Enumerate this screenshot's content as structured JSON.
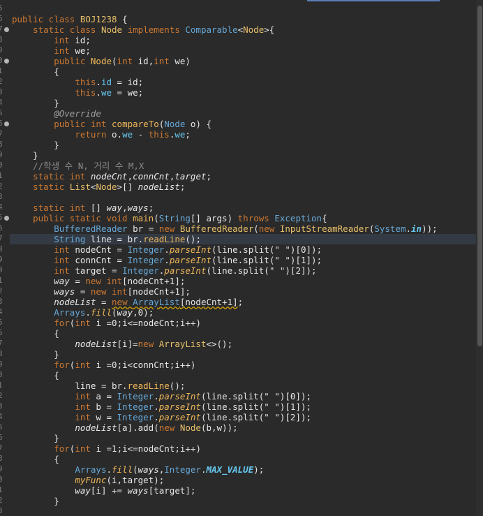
{
  "colors": {
    "background": "#2a2a2a",
    "keyword": "#cc7832",
    "type": "#66a8d8",
    "class": "#e8c06a",
    "field": "#66c8f0",
    "comment": "#8a8a8a"
  },
  "gutter": {
    "line_numbers": [
      "5",
      "6",
      "7",
      "8",
      "9",
      "0",
      "1",
      "2",
      "3",
      "4",
      "5",
      "6",
      "7",
      "8",
      "9",
      "0",
      "1",
      "2",
      "3",
      "4",
      "5",
      "6",
      "7",
      "8",
      "9",
      "0",
      "1",
      "2",
      "3",
      "4",
      "5",
      "6",
      "7",
      "8",
      "9",
      "0",
      "1",
      "2",
      "3",
      "4",
      "5",
      "6",
      "7",
      "8",
      "9",
      "0",
      "1",
      "2",
      "3"
    ]
  },
  "lines": [
    [
      [
        "kw",
        "public class "
      ],
      [
        "cls",
        "BOJ1238"
      ],
      [
        "plain",
        " {"
      ]
    ],
    [
      [
        "plain",
        "    "
      ],
      [
        "kw",
        "static class "
      ],
      [
        "cls",
        "Node"
      ],
      [
        "kw",
        " implements "
      ],
      [
        "type",
        "Comparable"
      ],
      [
        "plain",
        "<"
      ],
      [
        "cls",
        "Node"
      ],
      [
        "plain",
        ">{"
      ]
    ],
    [
      [
        "plain",
        "        "
      ],
      [
        "kw",
        "int "
      ],
      [
        "var",
        "id"
      ],
      [
        "plain",
        ";"
      ]
    ],
    [
      [
        "plain",
        "        "
      ],
      [
        "kw",
        "int "
      ],
      [
        "var",
        "we"
      ],
      [
        "plain",
        ";"
      ]
    ],
    [
      [
        "plain",
        "        "
      ],
      [
        "kw",
        "public "
      ],
      [
        "fn",
        "Node"
      ],
      [
        "plain",
        "("
      ],
      [
        "kw",
        "int "
      ],
      [
        "var",
        "id"
      ],
      [
        "plain",
        ","
      ],
      [
        "kw",
        "int "
      ],
      [
        "var",
        "we"
      ],
      [
        "plain",
        ")"
      ]
    ],
    [
      [
        "plain",
        "        {"
      ]
    ],
    [
      [
        "plain",
        "            "
      ],
      [
        "kw",
        "this"
      ],
      [
        "plain",
        "."
      ],
      [
        "fld",
        "id"
      ],
      [
        "plain",
        " = "
      ],
      [
        "var",
        "id"
      ],
      [
        "plain",
        ";"
      ]
    ],
    [
      [
        "plain",
        "            "
      ],
      [
        "kw",
        "this"
      ],
      [
        "plain",
        "."
      ],
      [
        "fld",
        "we"
      ],
      [
        "plain",
        " = "
      ],
      [
        "var",
        "we"
      ],
      [
        "plain",
        ";"
      ]
    ],
    [
      [
        "plain",
        "        }"
      ]
    ],
    [
      [
        "plain",
        "        "
      ],
      [
        "ann",
        "@Override"
      ]
    ],
    [
      [
        "plain",
        "        "
      ],
      [
        "kw",
        "public int "
      ],
      [
        "fn",
        "compareTo"
      ],
      [
        "plain",
        "("
      ],
      [
        "type",
        "Node "
      ],
      [
        "var",
        "o"
      ],
      [
        "plain",
        ") {"
      ]
    ],
    [
      [
        "plain",
        "            "
      ],
      [
        "kw",
        "return "
      ],
      [
        "var",
        "o"
      ],
      [
        "plain",
        "."
      ],
      [
        "fld",
        "we"
      ],
      [
        "plain",
        " - "
      ],
      [
        "kw",
        "this"
      ],
      [
        "plain",
        "."
      ],
      [
        "fld",
        "we"
      ],
      [
        "plain",
        ";"
      ]
    ],
    [
      [
        "plain",
        "        }"
      ]
    ],
    [
      [
        "plain",
        "    }"
      ]
    ],
    [
      [
        "plain",
        "    "
      ],
      [
        "cmt",
        "//학생 수 N, 거리 수 M,X"
      ]
    ],
    [
      [
        "plain",
        "    "
      ],
      [
        "kw",
        "static int "
      ],
      [
        "var it",
        "nodeCnt"
      ],
      [
        "plain",
        ","
      ],
      [
        "var it",
        "connCnt"
      ],
      [
        "plain",
        ","
      ],
      [
        "var it",
        "target"
      ],
      [
        "plain",
        ";"
      ]
    ],
    [
      [
        "plain",
        "    "
      ],
      [
        "kw",
        "static "
      ],
      [
        "cls",
        "List"
      ],
      [
        "plain",
        "<"
      ],
      [
        "cls",
        "Node"
      ],
      [
        "plain",
        ">[] "
      ],
      [
        "var it",
        "nodeList"
      ],
      [
        "plain",
        ";"
      ]
    ],
    [
      [
        "plain",
        ""
      ]
    ],
    [
      [
        "plain",
        "    "
      ],
      [
        "kw",
        "static int "
      ],
      [
        "plain",
        "[] "
      ],
      [
        "var it",
        "way"
      ],
      [
        "plain",
        ","
      ],
      [
        "var it",
        "ways"
      ],
      [
        "plain",
        ";"
      ]
    ],
    [
      [
        "plain",
        "    "
      ],
      [
        "kw",
        "public static void "
      ],
      [
        "fn",
        "main"
      ],
      [
        "plain",
        "("
      ],
      [
        "type",
        "String"
      ],
      [
        "plain",
        "[] "
      ],
      [
        "var",
        "args"
      ],
      [
        "plain",
        ") "
      ],
      [
        "kw",
        "throws "
      ],
      [
        "type",
        "Exception"
      ],
      [
        "plain",
        "{"
      ]
    ],
    [
      [
        "plain",
        "        "
      ],
      [
        "type",
        "BufferedReader "
      ],
      [
        "var",
        "br"
      ],
      [
        "plain",
        " = "
      ],
      [
        "kw",
        "new "
      ],
      [
        "cls",
        "BufferedReader"
      ],
      [
        "plain",
        "("
      ],
      [
        "kw",
        "new "
      ],
      [
        "cls",
        "InputStreamReader"
      ],
      [
        "plain",
        "("
      ],
      [
        "type",
        "System"
      ],
      [
        "plain",
        "."
      ],
      [
        "fld it bold",
        "in"
      ],
      [
        "plain",
        "));"
      ]
    ],
    [
      [
        "plain",
        "        "
      ],
      [
        "type",
        "String "
      ],
      [
        "var",
        "line"
      ],
      [
        "plain",
        " = "
      ],
      [
        "var",
        "br"
      ],
      [
        "plain",
        "."
      ],
      [
        "fn",
        "readLine"
      ],
      [
        "plain",
        "();"
      ]
    ],
    [
      [
        "plain",
        "        "
      ],
      [
        "kw",
        "int "
      ],
      [
        "var",
        "nodeCnt"
      ],
      [
        "plain",
        " = "
      ],
      [
        "type",
        "Integer"
      ],
      [
        "plain",
        "."
      ],
      [
        "fn it",
        "parseInt"
      ],
      [
        "plain",
        "(line.split("
      ],
      [
        "str",
        "\" \""
      ],
      [
        "plain",
        ")["
      ],
      [
        "num",
        "0"
      ],
      [
        "plain",
        "]);"
      ]
    ],
    [
      [
        "plain",
        "        "
      ],
      [
        "kw",
        "int "
      ],
      [
        "var",
        "connCnt"
      ],
      [
        "plain",
        " = "
      ],
      [
        "type",
        "Integer"
      ],
      [
        "plain",
        "."
      ],
      [
        "fn it",
        "parseInt"
      ],
      [
        "plain",
        "(line.split("
      ],
      [
        "str",
        "\" \""
      ],
      [
        "plain",
        ")["
      ],
      [
        "num",
        "1"
      ],
      [
        "plain",
        "]);"
      ]
    ],
    [
      [
        "plain",
        "        "
      ],
      [
        "kw",
        "int "
      ],
      [
        "var",
        "target"
      ],
      [
        "plain",
        " = "
      ],
      [
        "type",
        "Integer"
      ],
      [
        "plain",
        "."
      ],
      [
        "fn it",
        "parseInt"
      ],
      [
        "plain",
        "(line.split("
      ],
      [
        "str",
        "\" \""
      ],
      [
        "plain",
        ")["
      ],
      [
        "num",
        "2"
      ],
      [
        "plain",
        "]);"
      ]
    ],
    [
      [
        "plain",
        "        "
      ],
      [
        "var it",
        "way"
      ],
      [
        "plain",
        " = "
      ],
      [
        "kw",
        "new int"
      ],
      [
        "plain",
        "[nodeCnt+"
      ],
      [
        "num",
        "1"
      ],
      [
        "plain",
        "];"
      ]
    ],
    [
      [
        "plain",
        "        "
      ],
      [
        "var it",
        "ways"
      ],
      [
        "plain",
        " = "
      ],
      [
        "kw",
        "new int"
      ],
      [
        "plain",
        "[nodeCnt+"
      ],
      [
        "num",
        "1"
      ],
      [
        "plain",
        "];"
      ]
    ],
    [
      [
        "plain",
        "        "
      ],
      [
        "var it",
        "nodeList"
      ],
      [
        "plain",
        " = "
      ],
      [
        "kw squig",
        "new "
      ],
      [
        "type squig",
        "ArrayList"
      ],
      [
        "plain squig",
        "[nodeCnt+1]"
      ],
      [
        "plain",
        ";"
      ]
    ],
    [
      [
        "plain",
        "        "
      ],
      [
        "type",
        "Arrays"
      ],
      [
        "plain",
        "."
      ],
      [
        "fn it",
        "fill"
      ],
      [
        "plain",
        "("
      ],
      [
        "var it",
        "way"
      ],
      [
        "plain",
        ","
      ],
      [
        "num",
        "0"
      ],
      [
        "plain",
        ");"
      ]
    ],
    [
      [
        "plain",
        "        "
      ],
      [
        "kw",
        "for"
      ],
      [
        "plain",
        "("
      ],
      [
        "kw",
        "int "
      ],
      [
        "var",
        "i"
      ],
      [
        "plain",
        " ="
      ],
      [
        "num",
        "0"
      ],
      [
        "plain",
        ";i<=nodeCnt;i++)"
      ]
    ],
    [
      [
        "plain",
        "        {"
      ]
    ],
    [
      [
        "plain",
        "            "
      ],
      [
        "var it",
        "nodeList"
      ],
      [
        "plain",
        "[i]="
      ],
      [
        "kw",
        "new "
      ],
      [
        "cls",
        "ArrayList"
      ],
      [
        "plain",
        "<>();"
      ]
    ],
    [
      [
        "plain",
        "        }"
      ]
    ],
    [
      [
        "plain",
        "        "
      ],
      [
        "kw",
        "for"
      ],
      [
        "plain",
        "("
      ],
      [
        "kw",
        "int "
      ],
      [
        "var",
        "i"
      ],
      [
        "plain",
        " ="
      ],
      [
        "num",
        "0"
      ],
      [
        "plain",
        ";i<connCnt;i++)"
      ]
    ],
    [
      [
        "plain",
        "        {"
      ]
    ],
    [
      [
        "plain",
        "            "
      ],
      [
        "var",
        "line"
      ],
      [
        "plain",
        " = br."
      ],
      [
        "fn",
        "readLine"
      ],
      [
        "plain",
        "();"
      ]
    ],
    [
      [
        "plain",
        "            "
      ],
      [
        "kw",
        "int "
      ],
      [
        "var",
        "a"
      ],
      [
        "plain",
        " = "
      ],
      [
        "type",
        "Integer"
      ],
      [
        "plain",
        "."
      ],
      [
        "fn it",
        "parseInt"
      ],
      [
        "plain",
        "(line.split("
      ],
      [
        "str",
        "\" \""
      ],
      [
        "plain",
        ")["
      ],
      [
        "num",
        "0"
      ],
      [
        "plain",
        "]);"
      ]
    ],
    [
      [
        "plain",
        "            "
      ],
      [
        "kw",
        "int "
      ],
      [
        "var",
        "b"
      ],
      [
        "plain",
        " = "
      ],
      [
        "type",
        "Integer"
      ],
      [
        "plain",
        "."
      ],
      [
        "fn it",
        "parseInt"
      ],
      [
        "plain",
        "(line.split("
      ],
      [
        "str",
        "\" \""
      ],
      [
        "plain",
        ")["
      ],
      [
        "num",
        "1"
      ],
      [
        "plain",
        "]);"
      ]
    ],
    [
      [
        "plain",
        "            "
      ],
      [
        "kw",
        "int "
      ],
      [
        "var",
        "w"
      ],
      [
        "plain",
        " = "
      ],
      [
        "type",
        "Integer"
      ],
      [
        "plain",
        "."
      ],
      [
        "fn it",
        "parseInt"
      ],
      [
        "plain",
        "(line.split("
      ],
      [
        "str",
        "\" \""
      ],
      [
        "plain",
        ")["
      ],
      [
        "num",
        "2"
      ],
      [
        "plain",
        "]);"
      ]
    ],
    [
      [
        "plain",
        "            "
      ],
      [
        "var it",
        "nodeList"
      ],
      [
        "plain",
        "[a].add("
      ],
      [
        "kw",
        "new "
      ],
      [
        "cls",
        "Node"
      ],
      [
        "plain",
        "(b,w));"
      ]
    ],
    [
      [
        "plain",
        "        }"
      ]
    ],
    [
      [
        "plain",
        "        "
      ],
      [
        "kw",
        "for"
      ],
      [
        "plain",
        "("
      ],
      [
        "kw",
        "int "
      ],
      [
        "var",
        "i"
      ],
      [
        "plain",
        " ="
      ],
      [
        "num",
        "1"
      ],
      [
        "plain",
        ";i<=nodeCnt;i++)"
      ]
    ],
    [
      [
        "plain",
        "        {"
      ]
    ],
    [
      [
        "plain",
        "            "
      ],
      [
        "type",
        "Arrays"
      ],
      [
        "plain",
        "."
      ],
      [
        "fn it",
        "fill"
      ],
      [
        "plain",
        "("
      ],
      [
        "var it",
        "ways"
      ],
      [
        "plain",
        ","
      ],
      [
        "type",
        "Integer"
      ],
      [
        "plain",
        "."
      ],
      [
        "fld it bold",
        "MAX_VALUE"
      ],
      [
        "plain",
        ");"
      ]
    ],
    [
      [
        "plain",
        "            "
      ],
      [
        "fn it",
        "myFunc"
      ],
      [
        "plain",
        "(i,target);"
      ]
    ],
    [
      [
        "plain",
        "            "
      ],
      [
        "var it",
        "way"
      ],
      [
        "plain",
        "[i] += "
      ],
      [
        "var it",
        "ways"
      ],
      [
        "plain",
        "[target];"
      ]
    ],
    [
      [
        "plain",
        "        }"
      ]
    ]
  ]
}
